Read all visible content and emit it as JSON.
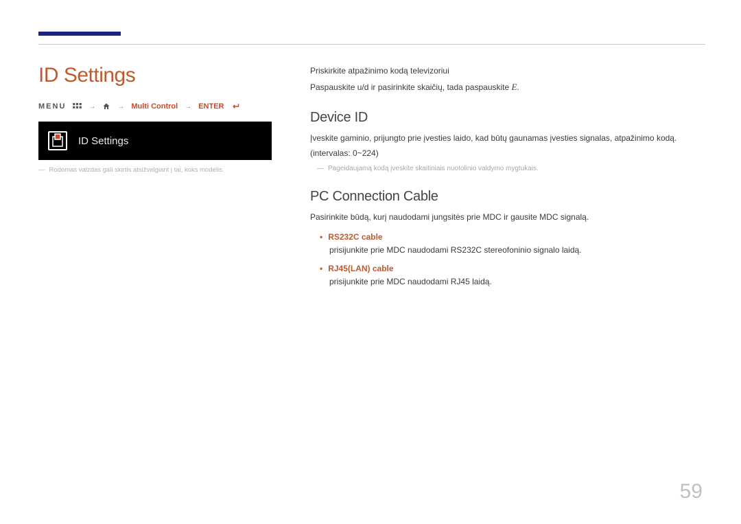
{
  "left": {
    "title": "ID Settings",
    "breadcrumb": {
      "menu": "MENU",
      "home_icon": "home-icon",
      "current": "Multi Control",
      "enter": "ENTER"
    },
    "thumb_label": "ID Settings",
    "note": "Rodomas vaizdas gali skirtis atsižvelgiant į tai, koks modelis."
  },
  "right": {
    "intro1": "Priskirkite atpažinimo kodą televizoriui",
    "intro2_pre": "Paspauskite ",
    "intro2_btn": "u/d",
    "intro2_mid": " ir pasirinkite skaičių, tada paspauskite ",
    "intro2_enter": "E",
    "section1": {
      "heading": "Device ID",
      "body": "Įveskite gaminio, prijungto prie įvesties laido, kad būtų gaunamas įvesties signalas, atpažinimo kodą. (intervalas: 0~224)",
      "subnote": "Pageidaujamą kodą įveskite skaitiniais nuotolinio valdymo mygtukais."
    },
    "section2": {
      "heading": "PC Connection Cable",
      "body": "Pasirinkite būdą, kurį naudodami jungsitės prie MDC ir gausite MDC signalą.",
      "opts": [
        {
          "label": "RS232C cable",
          "desc": "prisijunkite prie MDC naudodami RS232C stereofoninio signalo laidą."
        },
        {
          "label": "RJ45(LAN) cable",
          "desc": "prisijunkite prie MDC naudodami RJ45 laidą."
        }
      ]
    },
    "page_num": "59"
  }
}
